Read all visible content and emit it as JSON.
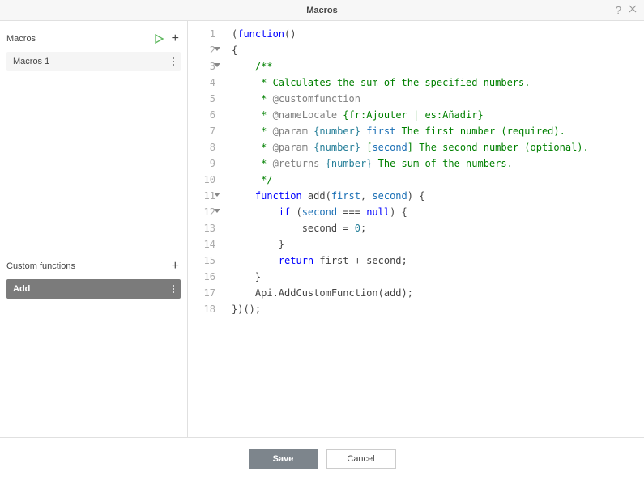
{
  "titlebar": {
    "title": "Macros",
    "help_tooltip": "?",
    "close_tooltip": "Close"
  },
  "sidebar": {
    "macros": {
      "title": "Macros",
      "items": [
        {
          "label": "Macros 1"
        }
      ]
    },
    "custom_functions": {
      "title": "Custom functions",
      "items": [
        {
          "label": "Add"
        }
      ]
    }
  },
  "editor": {
    "lines": [
      {
        "n": 1,
        "fold": false,
        "html": "<span class='tok-punct'>(</span><span class='tok-kw'>function</span><span class='tok-punct'>()</span>"
      },
      {
        "n": 2,
        "fold": true,
        "html": "<span class='tok-punct'>{</span>"
      },
      {
        "n": 3,
        "fold": true,
        "html": "    <span class='tok-comment'>/**</span>"
      },
      {
        "n": 4,
        "fold": false,
        "html": "    <span class='tok-comment'> * Calculates the sum of the specified numbers.</span>"
      },
      {
        "n": 5,
        "fold": false,
        "html": "    <span class='tok-comment'> * </span><span class='tok-doc-tag'>@customfunction</span>"
      },
      {
        "n": 6,
        "fold": false,
        "html": "    <span class='tok-comment'> * </span><span class='tok-doc-tag'>@nameLocale</span><span class='tok-comment'> {fr:Ajouter | es:Añadir}</span>"
      },
      {
        "n": 7,
        "fold": false,
        "html": "    <span class='tok-comment'> * </span><span class='tok-doc-tag'>@param</span><span class='tok-comment'> </span><span class='tok-type'>{number}</span><span class='tok-comment'> </span><span class='tok-param'>first</span><span class='tok-comment'> The first number (required).</span>"
      },
      {
        "n": 8,
        "fold": false,
        "html": "    <span class='tok-comment'> * </span><span class='tok-doc-tag'>@param</span><span class='tok-comment'> </span><span class='tok-type'>{number}</span><span class='tok-comment'> [</span><span class='tok-param'>second</span><span class='tok-comment'>] The second number (optional).</span>"
      },
      {
        "n": 9,
        "fold": false,
        "html": "    <span class='tok-comment'> * </span><span class='tok-doc-tag'>@returns</span><span class='tok-comment'> </span><span class='tok-type'>{number}</span><span class='tok-comment'> The sum of the numbers.</span>"
      },
      {
        "n": 10,
        "fold": false,
        "html": "    <span class='tok-comment'> */</span>"
      },
      {
        "n": 11,
        "fold": true,
        "html": "    <span class='tok-kw'>function</span> add(<span class='tok-param'>first</span>, <span class='tok-param'>second</span>) {"
      },
      {
        "n": 12,
        "fold": true,
        "html": "        <span class='tok-kw'>if</span> (<span class='tok-param'>second</span> === <span class='tok-kw'>null</span>) {"
      },
      {
        "n": 13,
        "fold": false,
        "html": "            second = <span class='tok-type'>0</span>;"
      },
      {
        "n": 14,
        "fold": false,
        "html": "        }"
      },
      {
        "n": 15,
        "fold": false,
        "html": "        <span class='tok-kw'>return</span> first + second;"
      },
      {
        "n": 16,
        "fold": false,
        "html": "    }"
      },
      {
        "n": 17,
        "fold": false,
        "html": "    Api.AddCustomFunction(add);"
      },
      {
        "n": 18,
        "fold": false,
        "html": "})();<span class='cursor-mark'></span>"
      }
    ]
  },
  "buttons": {
    "save": "Save",
    "cancel": "Cancel"
  }
}
